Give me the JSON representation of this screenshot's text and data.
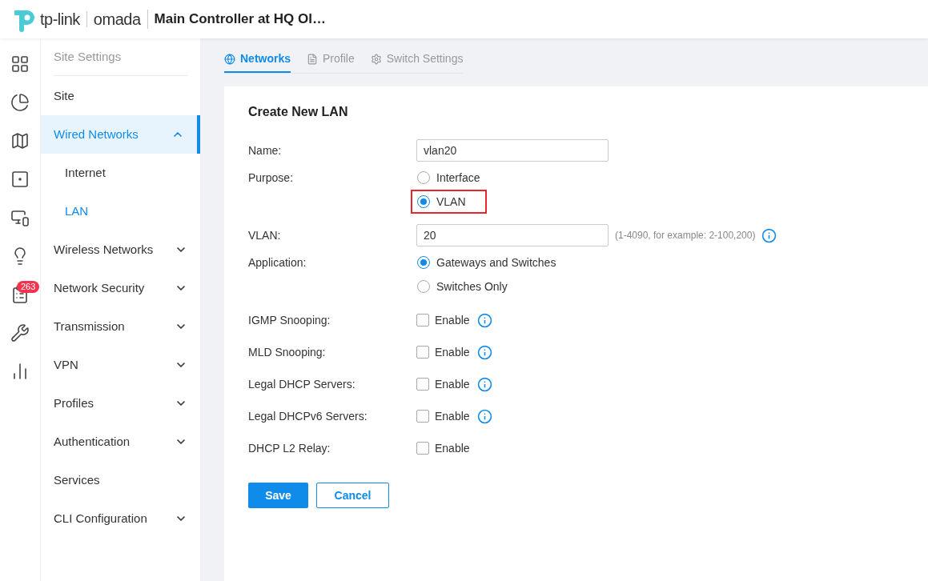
{
  "header": {
    "brand": "tp-link",
    "product": "omada",
    "title": "Main Controller at HQ Ol…"
  },
  "rail": [
    {
      "kind": "dashboard",
      "selected": false
    },
    {
      "kind": "statistics",
      "selected": false
    },
    {
      "kind": "map",
      "selected": false
    },
    {
      "kind": "devices",
      "selected": false
    },
    {
      "kind": "clients",
      "selected": false
    },
    {
      "kind": "insight",
      "selected": false
    },
    {
      "kind": "log",
      "selected": false,
      "badge": "263"
    },
    {
      "kind": "tools",
      "selected": false
    },
    {
      "kind": "reports",
      "selected": false
    }
  ],
  "sidebar": {
    "heading": "Site Settings",
    "items": [
      {
        "label": "Site",
        "selected": false
      },
      {
        "label": "Wired Networks",
        "selected": true,
        "kind": "group",
        "expanded": true,
        "children": [
          {
            "label": "Internet",
            "selected": false
          },
          {
            "label": "LAN",
            "selected": true
          }
        ]
      },
      {
        "label": "Wireless Networks",
        "selected": false,
        "kind": "group",
        "expanded": false
      },
      {
        "label": "Network Security",
        "selected": false,
        "kind": "group",
        "expanded": false
      },
      {
        "label": "Transmission",
        "selected": false,
        "kind": "group",
        "expanded": false
      },
      {
        "label": "VPN",
        "selected": false,
        "kind": "group",
        "expanded": false
      },
      {
        "label": "Profiles",
        "selected": false,
        "kind": "group",
        "expanded": false
      },
      {
        "label": "Authentication",
        "selected": false,
        "kind": "group",
        "expanded": false
      },
      {
        "label": "Services",
        "selected": false,
        "kind": "link"
      },
      {
        "label": "CLI Configuration",
        "selected": false,
        "kind": "group",
        "expanded": false
      }
    ]
  },
  "tabs": [
    {
      "label": "Networks",
      "selected": true
    },
    {
      "label": "Profile",
      "selected": false
    },
    {
      "label": "Switch Settings",
      "selected": false
    }
  ],
  "form": {
    "title": "Create New LAN",
    "rows": [
      {
        "kind": "text",
        "label": "Name:",
        "value": "vlan20"
      },
      {
        "kind": "radio",
        "label": "Purpose:",
        "options": [
          {
            "label": "Interface",
            "selected": false,
            "highlighted": false
          },
          {
            "label": "VLAN",
            "selected": true,
            "highlighted": true
          }
        ]
      },
      {
        "kind": "text",
        "label": "VLAN:",
        "value": "20",
        "hint": "(1-4090, for example: 2-100,200)",
        "info": true
      },
      {
        "kind": "radio",
        "label": "Application:",
        "options": [
          {
            "label": "Gateways and Switches",
            "selected": true,
            "highlighted": false
          },
          {
            "label": "Switches Only",
            "selected": false,
            "highlighted": false
          }
        ]
      },
      {
        "kind": "checkbox",
        "label": "IGMP Snooping:",
        "option": "Enable",
        "checked": false,
        "info": true
      },
      {
        "kind": "checkbox",
        "label": "MLD Snooping:",
        "option": "Enable",
        "checked": false,
        "info": true
      },
      {
        "kind": "checkbox",
        "label": "Legal DHCP Servers:",
        "option": "Enable",
        "checked": false,
        "info": true
      },
      {
        "kind": "checkbox",
        "label": "Legal DHCPv6 Servers:",
        "option": "Enable",
        "checked": false,
        "info": true
      },
      {
        "kind": "checkbox",
        "label": "DHCP L2 Relay:",
        "option": "Enable",
        "checked": false,
        "info": false
      }
    ],
    "buttons": [
      {
        "label": "Save",
        "kind": "primary"
      },
      {
        "label": "Cancel",
        "kind": "secondary"
      }
    ]
  }
}
